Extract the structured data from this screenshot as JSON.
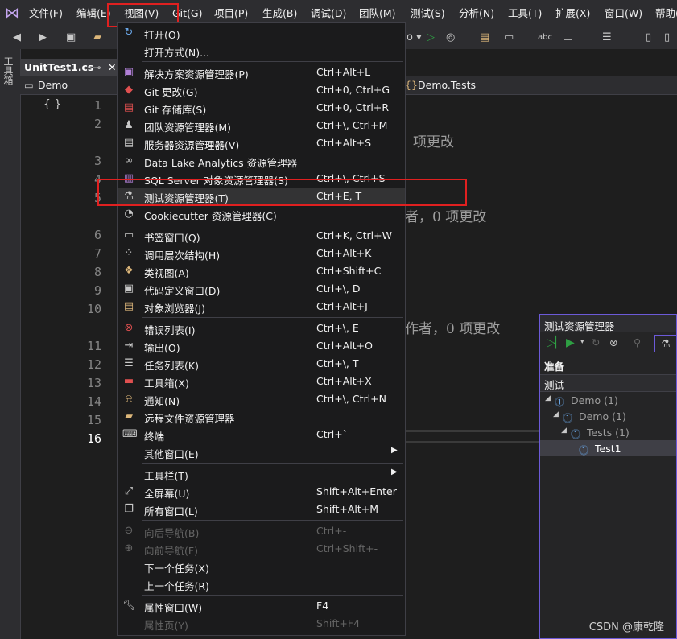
{
  "menubar": {
    "items": [
      "文件(F)",
      "编辑(E)",
      "视图(V)",
      "Git(G)",
      "项目(P)",
      "生成(B)",
      "调试(D)",
      "团队(M)",
      "测试(S)",
      "分析(N)",
      "工具(T)",
      "扩展(X)",
      "窗口(W)",
      "帮助("
    ]
  },
  "sidebar": {
    "toolbox_label": "工具箱"
  },
  "editor": {
    "tab_title": "UnitTest1.cs",
    "tab_pin": "⊸",
    "tab_close": "✕",
    "nav_left": "Demo",
    "nav_right": "Demo.Tests",
    "line_numbers": [
      "1",
      "2",
      "3",
      "4",
      "5",
      "6",
      "7",
      "8",
      "9",
      "10",
      "11",
      "12",
      "13",
      "14",
      "15",
      "16"
    ],
    "fragments": [
      "项更改",
      "者，0 项更改",
      "作者，0 项更改"
    ]
  },
  "view_menu": {
    "items": [
      {
        "label": "打开(O)",
        "shortcut": "",
        "icon": "open-icon"
      },
      {
        "label": "打开方式(N)...",
        "shortcut": "",
        "icon": ""
      },
      {
        "label": "解决方案资源管理器(P)",
        "shortcut": "Ctrl+Alt+L",
        "icon": "solution-explorer-icon"
      },
      {
        "label": "Git 更改(G)",
        "shortcut": "Ctrl+0, Ctrl+G",
        "icon": "git-changes-icon"
      },
      {
        "label": "Git 存储库(S)",
        "shortcut": "Ctrl+0, Ctrl+R",
        "icon": "git-repository-icon"
      },
      {
        "label": "团队资源管理器(M)",
        "shortcut": "Ctrl+\\, Ctrl+M",
        "icon": "team-explorer-icon"
      },
      {
        "label": "服务器资源管理器(V)",
        "shortcut": "Ctrl+Alt+S",
        "icon": "server-explorer-icon"
      },
      {
        "label": "Data Lake Analytics 资源管理器",
        "shortcut": "",
        "icon": "data-lake-icon"
      },
      {
        "label": "SQL Server 对象资源管理器(S)",
        "shortcut": "Ctrl+\\, Ctrl+S",
        "icon": "sql-server-icon"
      },
      {
        "label": "测试资源管理器(T)",
        "shortcut": "Ctrl+E, T",
        "icon": "test-explorer-icon"
      },
      {
        "label": "Cookiecutter 资源管理器(C)",
        "shortcut": "",
        "icon": "cookiecutter-icon"
      },
      {
        "label": "书签窗口(Q)",
        "shortcut": "Ctrl+K, Ctrl+W",
        "icon": "bookmark-icon"
      },
      {
        "label": "调用层次结构(H)",
        "shortcut": "Ctrl+Alt+K",
        "icon": "call-hierarchy-icon"
      },
      {
        "label": "类视图(A)",
        "shortcut": "Ctrl+Shift+C",
        "icon": "class-view-icon"
      },
      {
        "label": "代码定义窗口(D)",
        "shortcut": "Ctrl+\\, D",
        "icon": "code-definition-icon"
      },
      {
        "label": "对象浏览器(J)",
        "shortcut": "Ctrl+Alt+J",
        "icon": "object-browser-icon"
      },
      {
        "label": "错误列表(I)",
        "shortcut": "Ctrl+\\, E",
        "icon": "error-list-icon"
      },
      {
        "label": "输出(O)",
        "shortcut": "Ctrl+Alt+O",
        "icon": "output-icon"
      },
      {
        "label": "任务列表(K)",
        "shortcut": "Ctrl+\\, T",
        "icon": "task-list-icon"
      },
      {
        "label": "工具箱(X)",
        "shortcut": "Ctrl+Alt+X",
        "icon": "toolbox-icon"
      },
      {
        "label": "通知(N)",
        "shortcut": "Ctrl+\\, Ctrl+N",
        "icon": "notification-bell-icon"
      },
      {
        "label": "远程文件资源管理器",
        "shortcut": "",
        "icon": "remote-files-icon"
      },
      {
        "label": "终端",
        "shortcut": "Ctrl+`",
        "icon": "terminal-icon"
      },
      {
        "label": "其他窗口(E)",
        "shortcut": "",
        "icon": ""
      },
      {
        "label": "工具栏(T)",
        "shortcut": "",
        "icon": ""
      },
      {
        "label": "全屏幕(U)",
        "shortcut": "Shift+Alt+Enter",
        "icon": "fullscreen-icon"
      },
      {
        "label": "所有窗口(L)",
        "shortcut": "Shift+Alt+M",
        "icon": "all-windows-icon"
      },
      {
        "label": "向后导航(B)",
        "shortcut": "Ctrl+-",
        "icon": "navigate-back-icon"
      },
      {
        "label": "向前导航(F)",
        "shortcut": "Ctrl+Shift+-",
        "icon": "navigate-forward-icon"
      },
      {
        "label": "下一个任务(X)",
        "shortcut": "",
        "icon": ""
      },
      {
        "label": "上一个任务(R)",
        "shortcut": "",
        "icon": ""
      },
      {
        "label": "属性窗口(W)",
        "shortcut": "F4",
        "icon": "wrench-icon"
      },
      {
        "label": "属性页(Y)",
        "shortcut": "Shift+F4",
        "icon": ""
      }
    ]
  },
  "test_explorer": {
    "title": "测试资源管理器",
    "status": "准备",
    "column": "测试",
    "tree": [
      {
        "label": "Demo (1)"
      },
      {
        "label": "Demo (1)"
      },
      {
        "label": "Tests (1)"
      },
      {
        "label": "Test1"
      }
    ]
  },
  "watermark": "CSDN @康乾隆",
  "colors": {
    "accent_purple": "#6c5ad8",
    "highlight_red": "#e02020",
    "menu_bg": "#1b1b1c",
    "run_green": "#2ea043"
  }
}
